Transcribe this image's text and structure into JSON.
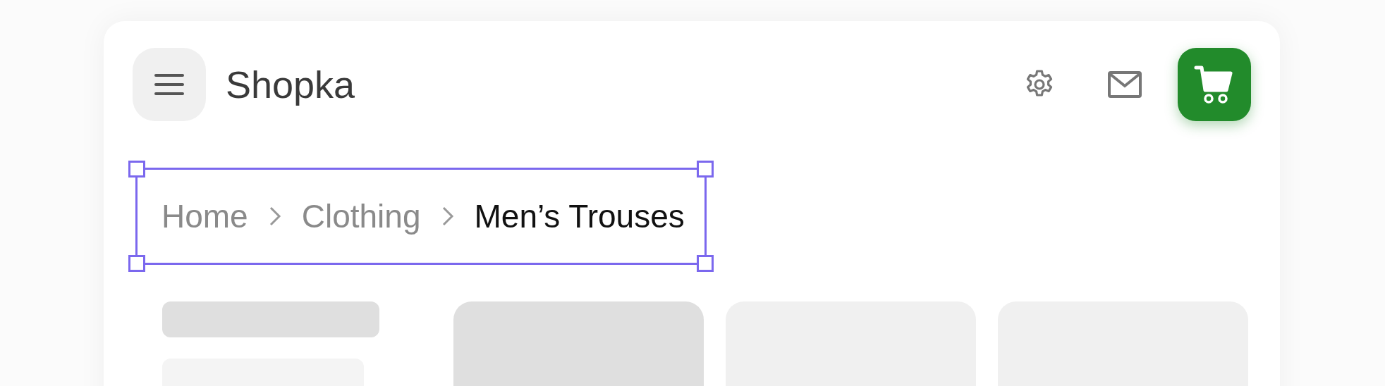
{
  "header": {
    "title": "Shopka"
  },
  "breadcrumb": {
    "selected": true,
    "items": [
      {
        "label": "Home",
        "current": false
      },
      {
        "label": "Clothing",
        "current": false
      },
      {
        "label": "Men’s Trouses",
        "current": true
      }
    ]
  }
}
